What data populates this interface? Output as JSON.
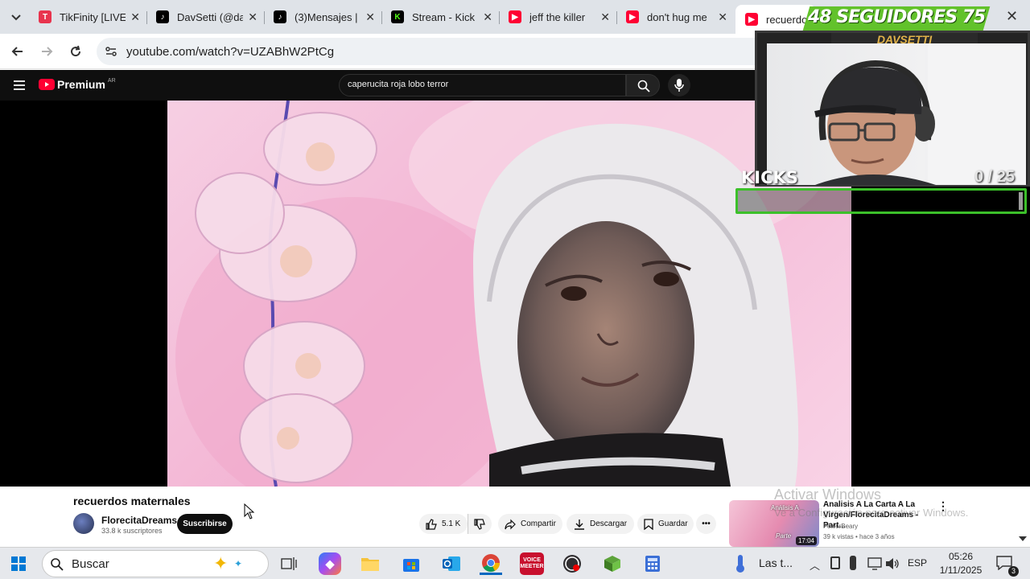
{
  "browser": {
    "tabs": [
      {
        "label": "TikFinity [LIVE",
        "favicon": "tikfinity-icon",
        "color": "#e8344e"
      },
      {
        "label": "DavSetti (@da",
        "favicon": "tiktok-icon",
        "color": "#000000"
      },
      {
        "label": "(3)Mensajes |",
        "favicon": "tiktok-icon",
        "color": "#000000"
      },
      {
        "label": "Stream - Kick",
        "favicon": "kick-icon",
        "color": "#53fc18"
      },
      {
        "label": "jeff the killer",
        "favicon": "youtube-icon",
        "color": "#ff0033"
      },
      {
        "label": "don't hug me",
        "favicon": "youtube-icon",
        "color": "#ff0033"
      },
      {
        "label": "recuerdo",
        "favicon": "youtube-icon",
        "color": "#ff0033"
      }
    ],
    "url": "youtube.com/watch?v=UZABhW2PtCg"
  },
  "youtube": {
    "logo_text": "Premium",
    "region_badge": "AR",
    "search_value": "caperucita roja lobo terror",
    "video": {
      "title": "recuerdos maternales",
      "channel": "FlorecitaDreams",
      "subscribers": "33.8 k suscriptores",
      "subscribe_label": "Suscribirse",
      "likes": "5.1 K",
      "share_label": "Compartir",
      "download_label": "Descargar",
      "save_label": "Guardar"
    },
    "related": {
      "title": "Analisis A La Carta A La Virgen/FlorecitaDreams - Part...",
      "channel": "FewerBeary",
      "meta": "39 k vistas • hace 3 años",
      "duration": "17:04",
      "thumb_text_top": "Análisis A",
      "thumb_text_bottom": "Parte"
    },
    "watermark": {
      "line1": "Activar Windows",
      "line2": "Ve a Configuración para activar Windows."
    }
  },
  "stream_overlay": {
    "followers_text": "48 SEGUIDORES 75",
    "streamer_name": "DAVSETTI",
    "kicks_label": "KICKS",
    "kicks_count": "0 / 25",
    "kicks_progress": 0
  },
  "taskbar": {
    "search_placeholder": "Buscar",
    "weather_text": "Las t...",
    "language": "ESP",
    "time": "05:26",
    "date": "1/11/2025",
    "notification_count": "3",
    "voicemeeter_label": "VOICE MEETER"
  }
}
